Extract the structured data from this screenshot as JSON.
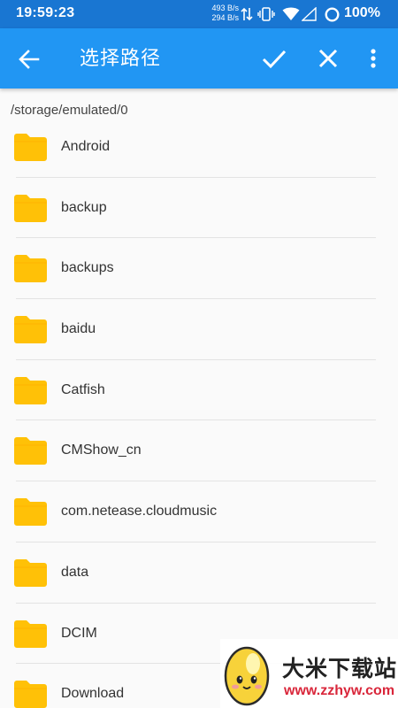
{
  "status_bar": {
    "time": "19:59:23",
    "speed_up": "493 B/s",
    "speed_down": "294 B/s",
    "battery": "100%"
  },
  "toolbar": {
    "title": "选择路径",
    "icons": [
      "arrow-back-icon",
      "checkmark-icon",
      "close-icon",
      "more-vert-icon"
    ]
  },
  "path": "/storage/emulated/0",
  "folders": [
    {
      "name": "Android"
    },
    {
      "name": "backup"
    },
    {
      "name": "backups"
    },
    {
      "name": "baidu"
    },
    {
      "name": "Catfish"
    },
    {
      "name": "CMShow_cn"
    },
    {
      "name": "com.netease.cloudmusic"
    },
    {
      "name": "data"
    },
    {
      "name": "DCIM"
    },
    {
      "name": "Download"
    }
  ],
  "watermark": {
    "title": "大米下载站",
    "url": "www.zzhyw.com"
  },
  "colors": {
    "status_bar": "#1976d2",
    "toolbar": "#2196f3",
    "folder": "#ffc107"
  }
}
